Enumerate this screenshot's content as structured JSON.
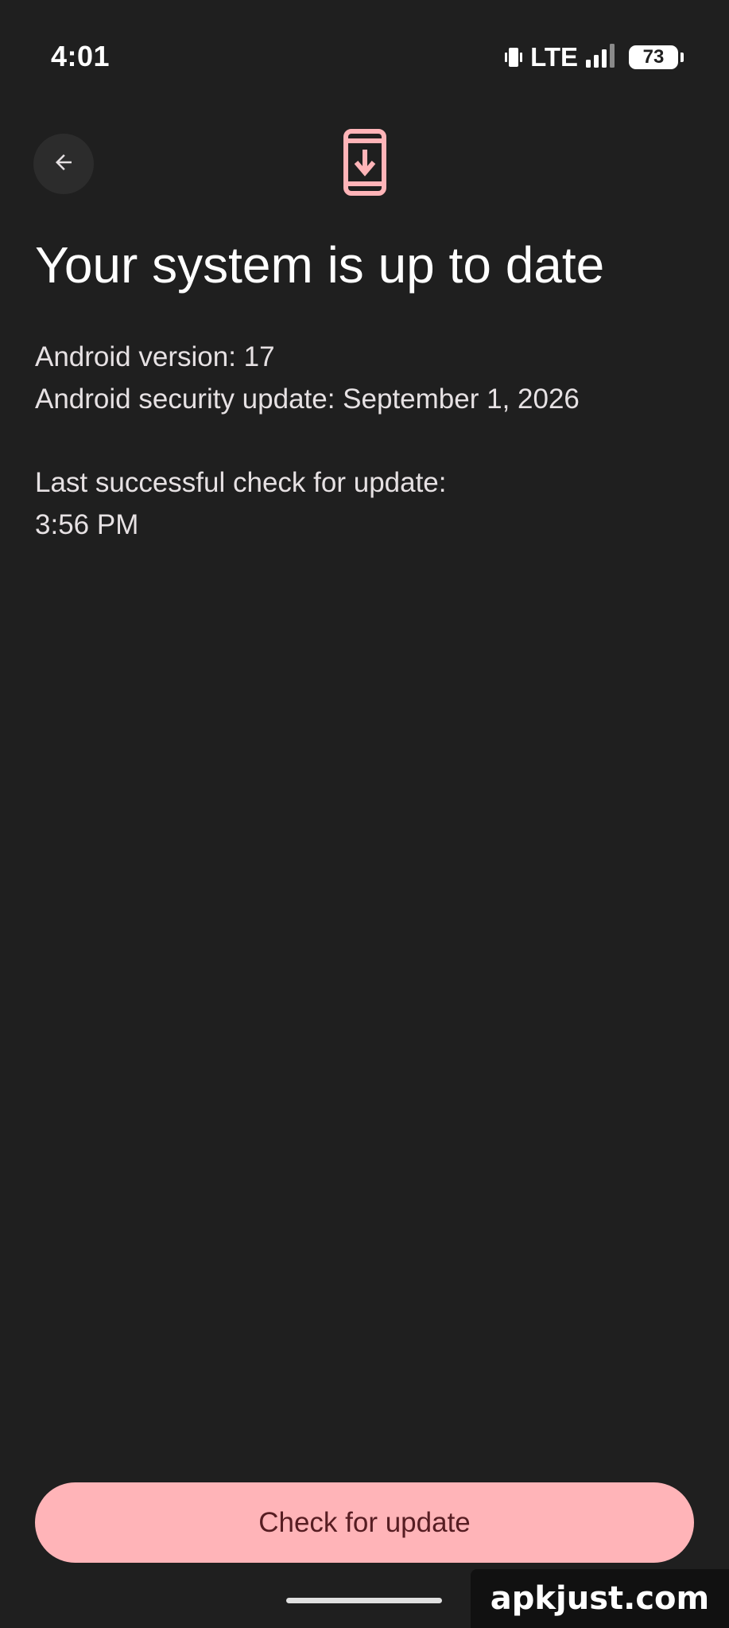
{
  "status_bar": {
    "time": "4:01",
    "network": "LTE",
    "battery_level": "73",
    "icons": [
      "vibrate-icon",
      "signal-icon",
      "battery-icon"
    ]
  },
  "header": {
    "back_icon": "arrow-left-icon",
    "top_icon": "system-update-icon",
    "accent_color": "#ffb4b8"
  },
  "main": {
    "title": "Your system is up to date",
    "android_version": "Android version: 17",
    "security_update": "Android security update: September 1, 2026",
    "last_check_label": "Last successful check for update:",
    "last_check_time": "3:56 PM"
  },
  "footer": {
    "check_button_label": "Check for update"
  },
  "watermark": {
    "text": "apkjust.com"
  }
}
